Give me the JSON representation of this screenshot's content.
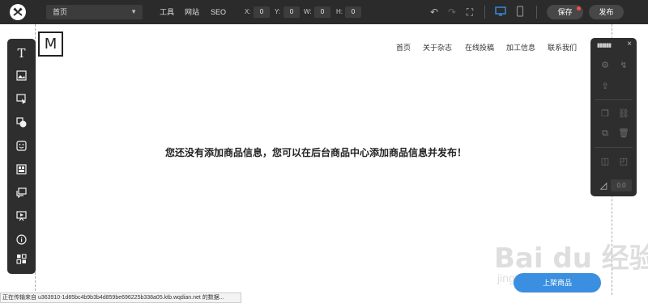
{
  "topbar": {
    "page_select": "首页",
    "menu": [
      "工具",
      "网站",
      "SEO"
    ],
    "coords": [
      {
        "label": "X:",
        "value": "0"
      },
      {
        "label": "Y:",
        "value": "0"
      },
      {
        "label": "W:",
        "value": "0"
      },
      {
        "label": "H:",
        "value": "0"
      }
    ],
    "save_label": "保存",
    "publish_label": "发布"
  },
  "left_tools": [
    {
      "name": "text-tool",
      "glyph": "T"
    },
    {
      "name": "image-tool",
      "glyph": "▣"
    },
    {
      "name": "select-tool",
      "glyph": "⬚"
    },
    {
      "name": "shape-tool",
      "glyph": "◔"
    },
    {
      "name": "icon-tool",
      "glyph": "☺"
    },
    {
      "name": "layout-tool",
      "glyph": "▦"
    },
    {
      "name": "comment-tool",
      "glyph": "▤"
    },
    {
      "name": "slideshow-tool",
      "glyph": "▶"
    },
    {
      "name": "info-tool",
      "glyph": "ⓘ"
    },
    {
      "name": "apps-tool",
      "glyph": "▣"
    }
  ],
  "site": {
    "logo_letter": "M",
    "nav": [
      "首页",
      "关于杂志",
      "在线投稿",
      "加工信息",
      "联系我们"
    ],
    "empty_message": "您还没有添加商品信息，您可以在后台商品中心添加商品信息并发布！",
    "bottom_button": "上架商品"
  },
  "right_panel": {
    "grip": "▮▮▮▮▮▮",
    "close": "×",
    "value": "0.0"
  },
  "statusbar_text": "正在传输来自 u363910-1d85bc4b9b3b4d859be696225b338a05.ktb.wqdian.net 的数据...",
  "watermark": {
    "main": "Bai du 经验",
    "sub": "jingyan.baidu.com"
  },
  "colors": {
    "toolbar": "#2b2b2b",
    "panel": "#2e2e2e",
    "accent_blue": "#3a8fe0",
    "device_active": "#3a8fe0",
    "notify_red": "#ff4a4a"
  }
}
